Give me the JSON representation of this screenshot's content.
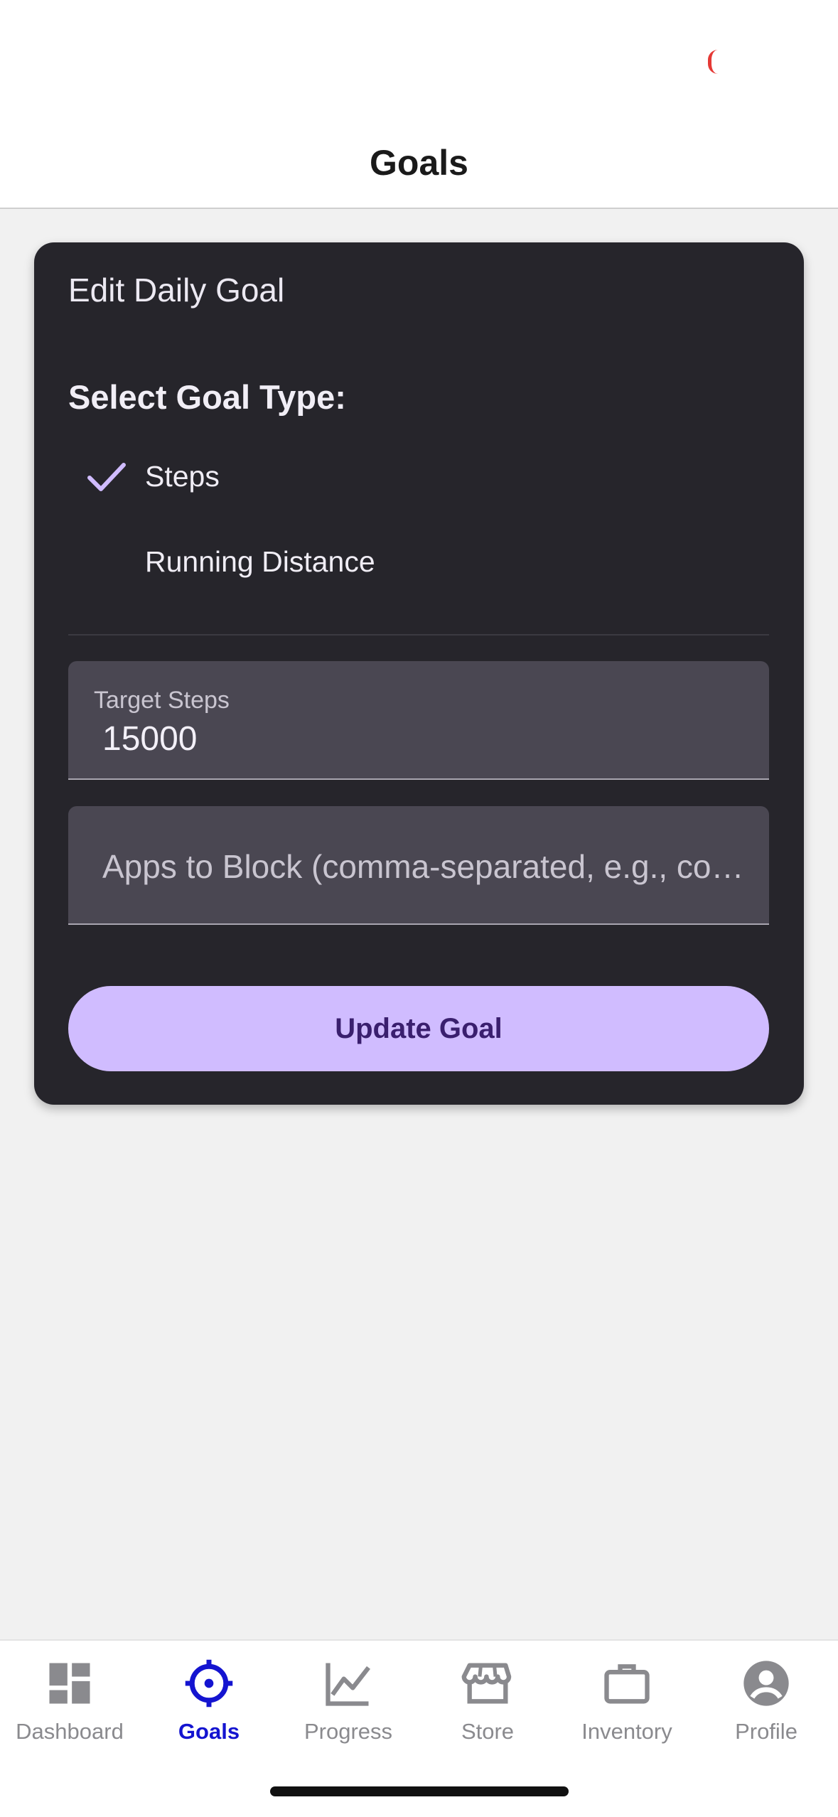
{
  "header": {
    "title": "Goals"
  },
  "card": {
    "title": "Edit Daily Goal",
    "goal_type_label": "Select Goal Type:",
    "options": [
      {
        "label": "Steps",
        "selected": true
      },
      {
        "label": "Running Distance",
        "selected": false
      }
    ],
    "target_field": {
      "label": "Target Steps",
      "value": "15000"
    },
    "apps_field": {
      "placeholder": "Apps to Block (comma-separated, e.g., com.instagram.android)"
    },
    "update_button": "Update Goal"
  },
  "nav": {
    "items": [
      {
        "label": "Dashboard",
        "icon": "dashboard-icon",
        "active": false
      },
      {
        "label": "Goals",
        "icon": "crosshair-icon",
        "active": true
      },
      {
        "label": "Progress",
        "icon": "chart-icon",
        "active": false
      },
      {
        "label": "Store",
        "icon": "store-icon",
        "active": false
      },
      {
        "label": "Inventory",
        "icon": "briefcase-icon",
        "active": false
      },
      {
        "label": "Profile",
        "icon": "account-icon",
        "active": false
      }
    ]
  },
  "colors": {
    "card_bg": "#26252b",
    "accent": "#d0bcff",
    "nav_active": "#1414d0",
    "nav_inactive": "#8a8a8e"
  }
}
